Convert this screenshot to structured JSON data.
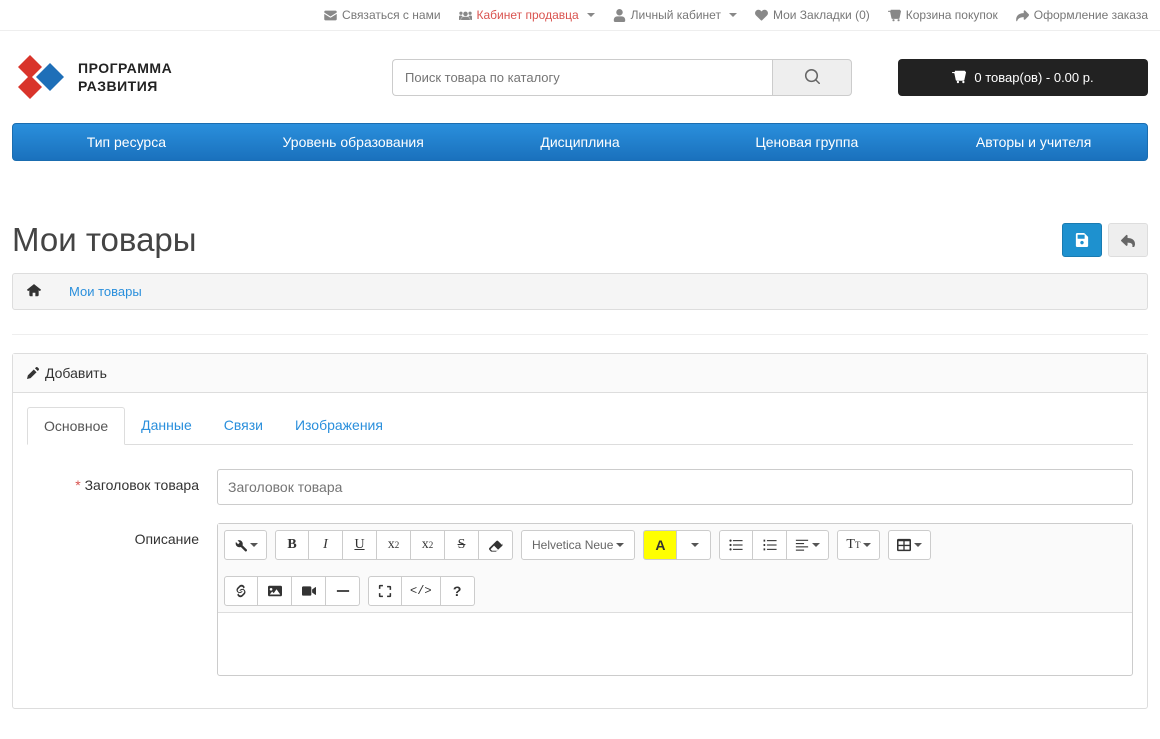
{
  "topbar": {
    "contact": "Связаться с нами",
    "seller": "Кабинет продавца",
    "account": "Личный кабинет",
    "wishlist": "Мои Закладки (0)",
    "cart": "Корзина покупок",
    "checkout": "Оформление заказа"
  },
  "logo": {
    "line1": "ПРОГРАММА",
    "line2": "РАЗВИТИЯ"
  },
  "search": {
    "placeholder": "Поиск товара по каталогу"
  },
  "cart_btn": "0 товар(ов) - 0.00 р.",
  "nav": {
    "n1": "Тип ресурса",
    "n2": "Уровень образования",
    "n3": "Дисциплина",
    "n4": "Ценовая группа",
    "n5": "Авторы и учителя"
  },
  "page": {
    "title": "Мои товары"
  },
  "breadcrumb": {
    "b1": "Мои товары"
  },
  "panel": {
    "title": "Добавить"
  },
  "tabs": {
    "t1": "Основное",
    "t2": "Данные",
    "t3": "Связи",
    "t4": "Изображения"
  },
  "form": {
    "title_label": "Заголовок товара",
    "title_placeholder": "Заголовок товара",
    "desc_label": "Описание"
  },
  "editor": {
    "font": "Helvetica Neue"
  }
}
